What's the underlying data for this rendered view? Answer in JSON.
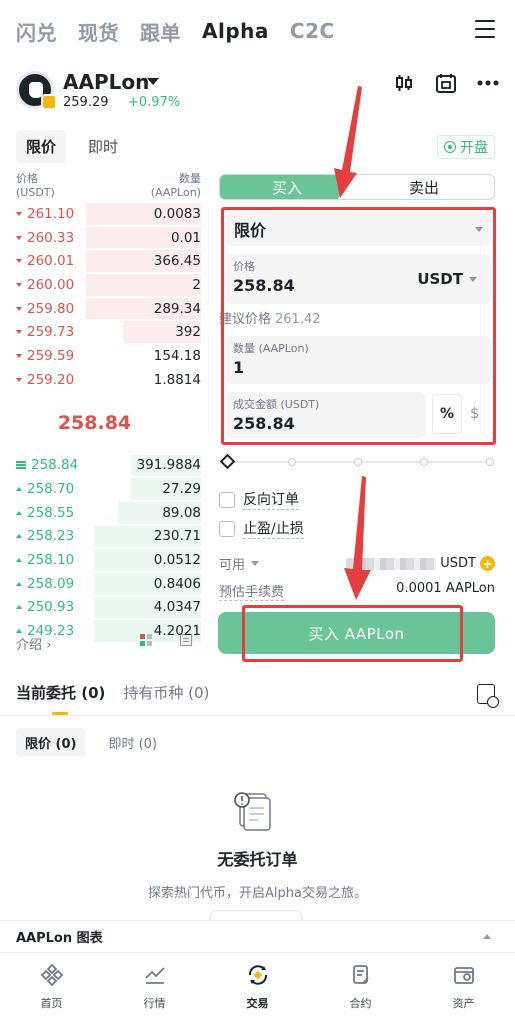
{
  "topnav": {
    "tabs": [
      "闪兑",
      "现货",
      "跟单",
      "Alpha",
      "C2C"
    ],
    "active": "Alpha"
  },
  "asset": {
    "symbol": "AAPLon",
    "price": "259.29",
    "change": "+0.97%"
  },
  "order_type_tabs": [
    "限价",
    "即时"
  ],
  "market_status": "开盘",
  "orderbook": {
    "price_header": [
      "价格",
      "(USDT)"
    ],
    "qty_header": [
      "数量",
      "(AAPLon)"
    ],
    "asks": [
      {
        "price": "261.10",
        "qty": "0.0083",
        "depth": 0.62
      },
      {
        "price": "260.33",
        "qty": "0.01",
        "depth": 0.62
      },
      {
        "price": "260.01",
        "qty": "366.45",
        "depth": 0.62
      },
      {
        "price": "260.00",
        "qty": "2",
        "depth": 0.62
      },
      {
        "price": "259.80",
        "qty": "289.34",
        "depth": 0.62
      },
      {
        "price": "259.73",
        "qty": "392",
        "depth": 0.42
      },
      {
        "price": "259.59",
        "qty": "154.18",
        "depth": 0
      },
      {
        "price": "259.20",
        "qty": "1.8814",
        "depth": 0
      }
    ],
    "mid_price": "258.84",
    "bids": [
      {
        "price": "258.84",
        "qty": "391.9884",
        "depth": 0.38
      },
      {
        "price": "258.70",
        "qty": "27.29",
        "depth": 0.38
      },
      {
        "price": "258.55",
        "qty": "89.08",
        "depth": 0.45
      },
      {
        "price": "258.23",
        "qty": "230.71",
        "depth": 0.58
      },
      {
        "price": "258.10",
        "qty": "0.0512",
        "depth": 0.58
      },
      {
        "price": "258.09",
        "qty": "0.8406",
        "depth": 0.58
      },
      {
        "price": "250.93",
        "qty": "4.0347",
        "depth": 0.58
      },
      {
        "price": "249.23",
        "qty": "4.2021",
        "depth": 0.58
      }
    ],
    "footer_link": "介绍 ›"
  },
  "trade": {
    "buy_label": "买入",
    "sell_label": "卖出",
    "order_type": "限价",
    "price_label": "价格",
    "price_value": "258.84",
    "price_unit": "USDT",
    "suggest_label": "建议价格",
    "suggest_value": "261.42",
    "qty_label": "数量 (AAPLon)",
    "qty_value": "1",
    "amount_label": "成交金额 (USDT)",
    "amount_value": "258.84",
    "pct_label": "%",
    "dollar_label": "$",
    "reverse_order": "反向订单",
    "tp_sl": "止盈/止损",
    "available_label": "可用",
    "available_unit": "USDT",
    "fee_label": "预估手续费",
    "fee_value": "0.0001 AAPLon",
    "submit_label": "买入 AAPLon"
  },
  "orders": {
    "tabs": [
      "当前委托 (0)",
      "持有币种 (0)"
    ],
    "sub_tabs": [
      "限价 (0)",
      "即时 (0)"
    ],
    "empty_title": "无委托订单",
    "empty_subtitle": "探索热门代币，开启Alpha交易之旅。"
  },
  "chart_bar": "AAPLon 图表",
  "bottomnav": [
    "首页",
    "行情",
    "交易",
    "合约",
    "资产"
  ],
  "colors": {
    "buy": "#6bc497",
    "ask": "#d9534f",
    "bid": "#2ebd85",
    "annotation": "#e53e3e",
    "accent": "#f0b90b"
  }
}
